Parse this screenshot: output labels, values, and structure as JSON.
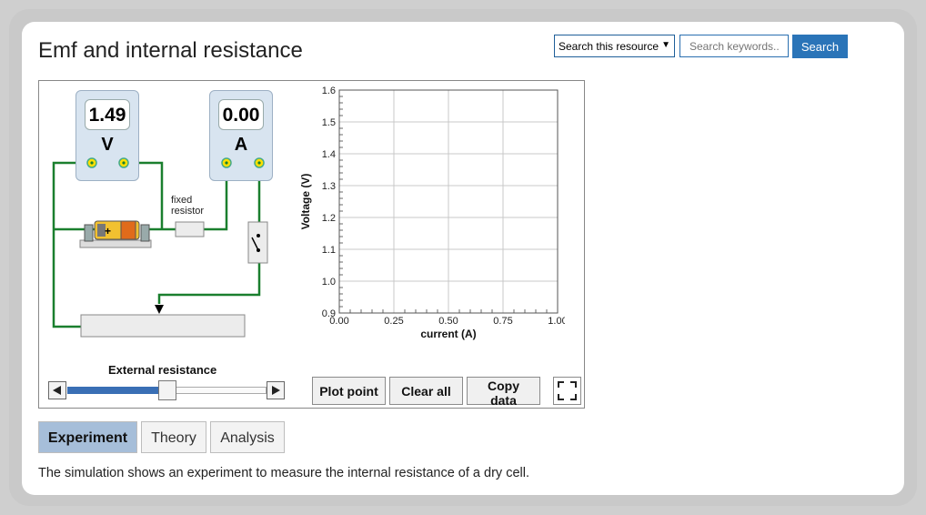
{
  "page": {
    "title": "Emf and internal resistance"
  },
  "search": {
    "select_label": "Search this resource",
    "placeholder": "Search keywords..",
    "button_label": "Search"
  },
  "sim": {
    "voltmeter": {
      "value": "1.49",
      "unit": "V"
    },
    "ammeter": {
      "value": "0.00",
      "unit": "A"
    },
    "fixed_resistor_label_1": "fixed",
    "fixed_resistor_label_2": "resistor",
    "slider_label": "External resistance",
    "slider_value": 0.5,
    "buttons": {
      "plot": "Plot point",
      "clear": "Clear all",
      "copy": "Copy data"
    }
  },
  "chart_data": {
    "type": "scatter",
    "xlabel": "current (A)",
    "ylabel": "Voltage (V)",
    "xlim": [
      0,
      1
    ],
    "ylim": [
      0.9,
      1.6
    ],
    "x_ticks": [
      "0.00",
      "0.25",
      "0.50",
      "0.75",
      "1.00"
    ],
    "y_ticks": [
      "0.9",
      "1.0",
      "1.1",
      "1.2",
      "1.3",
      "1.4",
      "1.5",
      "1.6"
    ],
    "series": [],
    "grid": true
  },
  "tabs": [
    "Experiment",
    "Theory",
    "Analysis"
  ],
  "description": "The simulation shows an experiment to measure the internal resistance of a dry cell.",
  "colors": {
    "wire": "#1a7f2e",
    "accent": "#2a74b8",
    "active_tab": "#a6bed9"
  }
}
